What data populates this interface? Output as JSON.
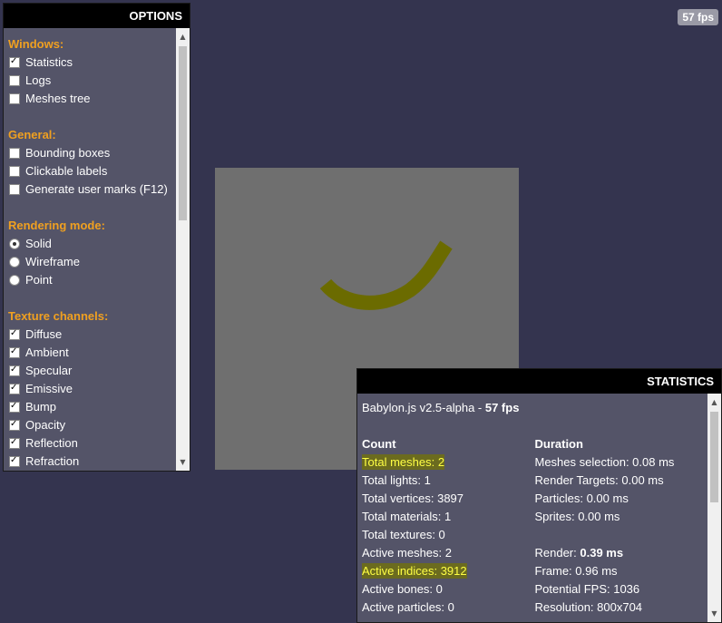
{
  "fps_badge": "57 fps",
  "options": {
    "title": "OPTIONS",
    "sections": [
      {
        "heading": "Windows:",
        "items": [
          {
            "label": "Statistics",
            "type": "checkbox",
            "checked": true
          },
          {
            "label": "Logs",
            "type": "checkbox",
            "checked": false
          },
          {
            "label": "Meshes tree",
            "type": "checkbox",
            "checked": false
          }
        ]
      },
      {
        "heading": "General:",
        "items": [
          {
            "label": "Bounding boxes",
            "type": "checkbox",
            "checked": false
          },
          {
            "label": "Clickable labels",
            "type": "checkbox",
            "checked": false
          },
          {
            "label": "Generate user marks (F12)",
            "type": "checkbox",
            "checked": false
          }
        ]
      },
      {
        "heading": "Rendering mode:",
        "items": [
          {
            "label": "Solid",
            "type": "radio",
            "checked": true
          },
          {
            "label": "Wireframe",
            "type": "radio",
            "checked": false
          },
          {
            "label": "Point",
            "type": "radio",
            "checked": false
          }
        ]
      },
      {
        "heading": "Texture channels:",
        "items": [
          {
            "label": "Diffuse",
            "type": "checkbox",
            "checked": true
          },
          {
            "label": "Ambient",
            "type": "checkbox",
            "checked": true
          },
          {
            "label": "Specular",
            "type": "checkbox",
            "checked": true
          },
          {
            "label": "Emissive",
            "type": "checkbox",
            "checked": true
          },
          {
            "label": "Bump",
            "type": "checkbox",
            "checked": true
          },
          {
            "label": "Opacity",
            "type": "checkbox",
            "checked": true
          },
          {
            "label": "Reflection",
            "type": "checkbox",
            "checked": true
          },
          {
            "label": "Refraction",
            "type": "checkbox",
            "checked": true
          }
        ]
      }
    ]
  },
  "statistics": {
    "title": "STATISTICS",
    "version_prefix": "Babylon.js v2.5-alpha - ",
    "version_fps": "57 fps",
    "count_heading": "Count",
    "duration_heading": "Duration",
    "count_rows": [
      {
        "text": "Total meshes: 2",
        "highlight": true
      },
      {
        "text": "Total lights: 1",
        "highlight": false
      },
      {
        "text": "Total vertices: 3897",
        "highlight": false
      },
      {
        "text": "Total materials: 1",
        "highlight": false
      },
      {
        "text": "Total textures: 0",
        "highlight": false
      },
      {
        "text": "Active meshes: 2",
        "highlight": false
      },
      {
        "text": "Active indices: 3912",
        "highlight": true
      },
      {
        "text": "Active bones: 0",
        "highlight": false
      },
      {
        "text": "Active particles: 0",
        "highlight": false
      }
    ],
    "duration_rows": [
      {
        "label": "Meshes selection: ",
        "value": "0.08 ms",
        "bold": false
      },
      {
        "label": "Render Targets: ",
        "value": "0.00 ms",
        "bold": false
      },
      {
        "label": "Particles: ",
        "value": "0.00 ms",
        "bold": false
      },
      {
        "label": "Sprites: ",
        "value": "0.00 ms",
        "bold": false
      },
      {
        "label": "",
        "value": "",
        "bold": false
      },
      {
        "label": "Render: ",
        "value": "0.39 ms",
        "bold": true
      },
      {
        "label": "Frame: ",
        "value": "0.96 ms",
        "bold": false
      },
      {
        "label": "Potential FPS: ",
        "value": "1036",
        "bold": false
      },
      {
        "label": "Resolution: ",
        "value": "800x704",
        "bold": false
      }
    ]
  },
  "colors": {
    "background": "#34344f",
    "panel": "#545468",
    "heading_orange": "#f0a020",
    "curve": "#6b6b00"
  }
}
